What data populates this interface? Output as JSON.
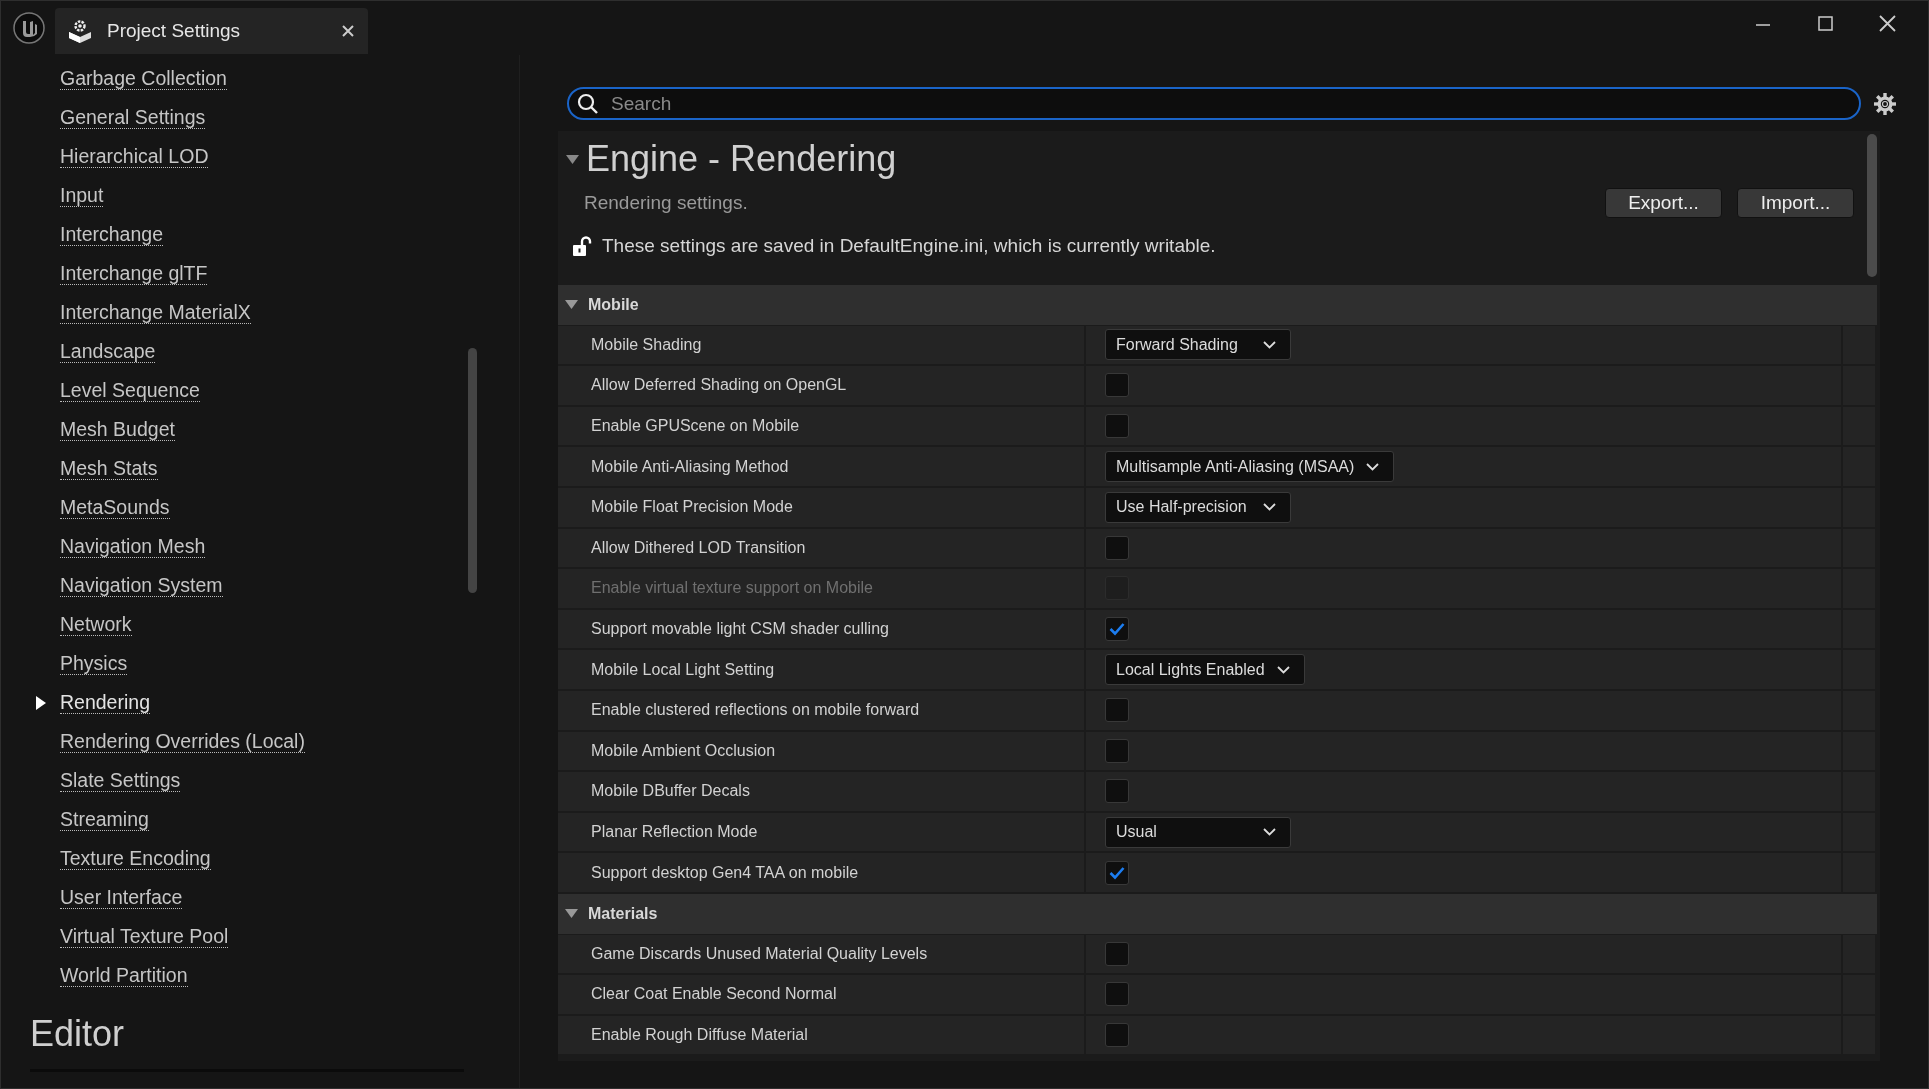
{
  "window": {
    "tab": {
      "title": "Project Settings"
    }
  },
  "sidebar": {
    "items": [
      {
        "label": "Garbage Collection",
        "selected": false
      },
      {
        "label": "General Settings",
        "selected": false
      },
      {
        "label": "Hierarchical LOD",
        "selected": false
      },
      {
        "label": "Input",
        "selected": false
      },
      {
        "label": "Interchange",
        "selected": false
      },
      {
        "label": "Interchange glTF",
        "selected": false
      },
      {
        "label": "Interchange MaterialX",
        "selected": false
      },
      {
        "label": "Landscape",
        "selected": false
      },
      {
        "label": "Level Sequence",
        "selected": false
      },
      {
        "label": "Mesh Budget",
        "selected": false
      },
      {
        "label": "Mesh Stats",
        "selected": false
      },
      {
        "label": "MetaSounds",
        "selected": false
      },
      {
        "label": "Navigation Mesh",
        "selected": false
      },
      {
        "label": "Navigation System",
        "selected": false
      },
      {
        "label": "Network",
        "selected": false
      },
      {
        "label": "Physics",
        "selected": false
      },
      {
        "label": "Rendering",
        "selected": true
      },
      {
        "label": "Rendering Overrides (Local)",
        "selected": false
      },
      {
        "label": "Slate Settings",
        "selected": false
      },
      {
        "label": "Streaming",
        "selected": false
      },
      {
        "label": "Texture Encoding",
        "selected": false
      },
      {
        "label": "User Interface",
        "selected": false
      },
      {
        "label": "Virtual Texture Pool",
        "selected": false
      },
      {
        "label": "World Partition",
        "selected": false
      }
    ],
    "section_heading": "Editor"
  },
  "search": {
    "placeholder": "Search"
  },
  "details": {
    "title": "Engine - Rendering",
    "description": "Rendering settings.",
    "buttons": [
      "Export...",
      "Import..."
    ],
    "config_note": "These settings are saved in DefaultEngine.ini, which is currently writable.",
    "categories": [
      {
        "name": "Mobile",
        "expanded": true,
        "rows": [
          {
            "label": "Mobile Shading",
            "kind": "dropdown",
            "value": "Forward Shading",
            "disabled": false
          },
          {
            "label": "Allow Deferred Shading on OpenGL",
            "kind": "checkbox",
            "checked": false,
            "disabled": false
          },
          {
            "label": "Enable GPUScene on Mobile",
            "kind": "checkbox",
            "checked": false,
            "disabled": false
          },
          {
            "label": "Mobile Anti-Aliasing Method",
            "kind": "dropdown",
            "value": "Multisample Anti-Aliasing (MSAA)",
            "disabled": false
          },
          {
            "label": "Mobile Float Precision Mode",
            "kind": "dropdown",
            "value": "Use Half-precision",
            "disabled": false
          },
          {
            "label": "Allow Dithered LOD Transition",
            "kind": "checkbox",
            "checked": false,
            "disabled": false
          },
          {
            "label": "Enable virtual texture support on Mobile",
            "kind": "checkbox",
            "checked": false,
            "disabled": true
          },
          {
            "label": "Support movable light CSM shader culling",
            "kind": "checkbox",
            "checked": true,
            "disabled": false
          },
          {
            "label": "Mobile Local Light Setting",
            "kind": "dropdown",
            "value": "Local Lights Enabled",
            "disabled": false
          },
          {
            "label": "Enable clustered reflections on mobile forward",
            "kind": "checkbox",
            "checked": false,
            "disabled": false
          },
          {
            "label": "Mobile Ambient Occlusion",
            "kind": "checkbox",
            "checked": false,
            "disabled": false
          },
          {
            "label": "Mobile DBuffer Decals",
            "kind": "checkbox",
            "checked": false,
            "disabled": false
          },
          {
            "label": "Planar Reflection Mode",
            "kind": "dropdown",
            "value": "Usual",
            "disabled": false
          },
          {
            "label": "Support desktop Gen4 TAA on mobile",
            "kind": "checkbox",
            "checked": true,
            "disabled": false
          }
        ]
      },
      {
        "name": "Materials",
        "expanded": true,
        "rows": [
          {
            "label": "Game Discards Unused Material Quality Levels",
            "kind": "checkbox",
            "checked": false,
            "disabled": false
          },
          {
            "label": "Clear Coat Enable Second Normal",
            "kind": "checkbox",
            "checked": false,
            "disabled": false
          },
          {
            "label": "Enable Rough Diffuse Material",
            "kind": "checkbox",
            "checked": false,
            "disabled": false
          }
        ]
      }
    ]
  }
}
